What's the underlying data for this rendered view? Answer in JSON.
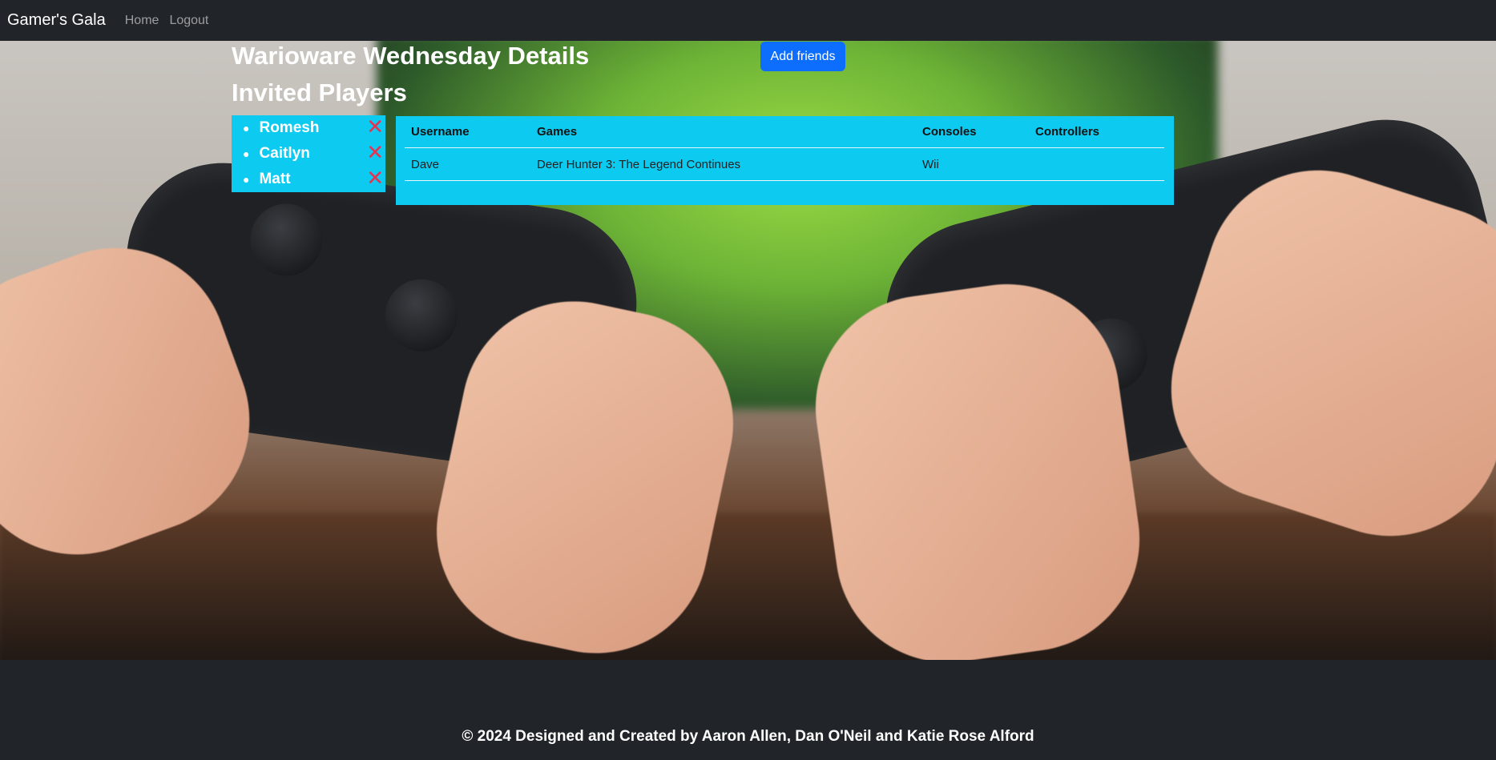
{
  "navbar": {
    "brand": "Gamer's Gala",
    "links": [
      "Home",
      "Logout"
    ]
  },
  "hero": {
    "image_alt": "hands-holding-game-controllers-photo"
  },
  "page": {
    "title": "Warioware Wednesday Details",
    "subtitle": "Invited Players",
    "add_button": "Add friends"
  },
  "invited_players": [
    {
      "name": "Romesh",
      "remove_glyph": "✕"
    },
    {
      "name": "Caitlyn",
      "remove_glyph": "✕"
    },
    {
      "name": "Matt",
      "remove_glyph": "✕"
    }
  ],
  "table": {
    "headers": [
      "Username",
      "Games",
      "Consoles",
      "Controllers"
    ],
    "rows": [
      [
        "Dave",
        "Deer Hunter 3: The Legend Continues",
        "Wii",
        ""
      ]
    ]
  },
  "footer": {
    "text": "© 2024 Designed and Created by Aaron Allen, Dan O'Neil and Katie Rose Alford"
  },
  "colors": {
    "navbar": "#212529",
    "primary": "#0d6efd",
    "info": "#0dcaf0",
    "remove": "#e8324f"
  }
}
